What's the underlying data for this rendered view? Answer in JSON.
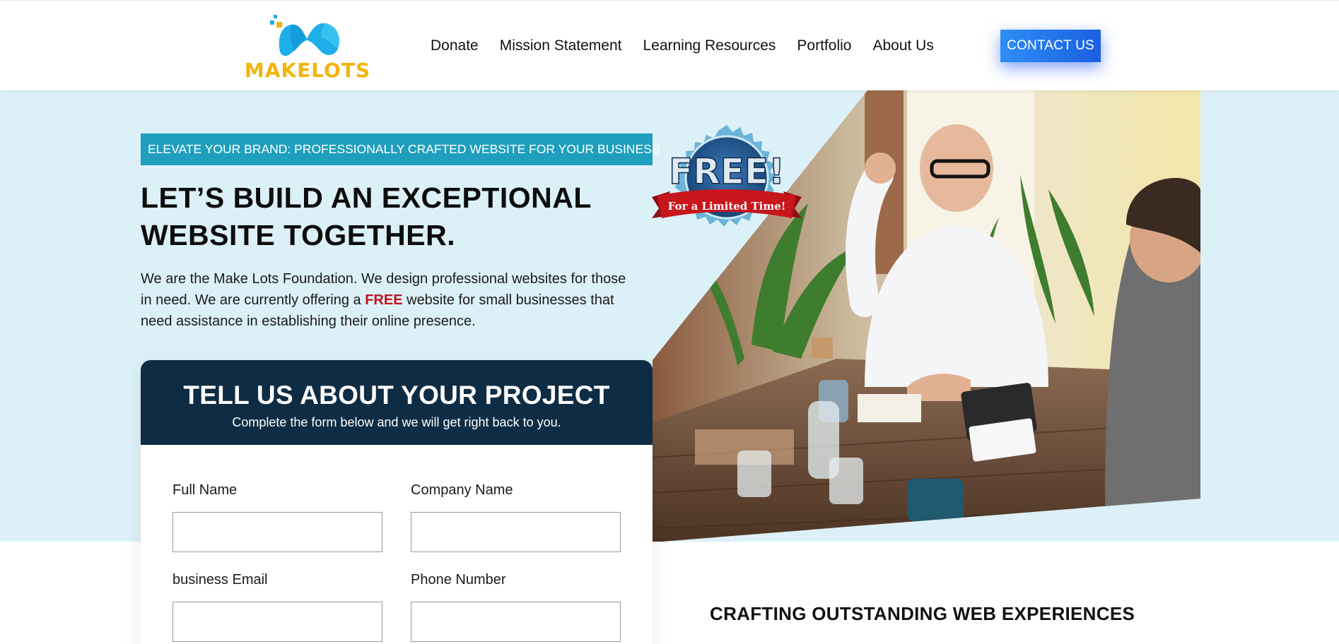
{
  "brand": {
    "name": "MAKELOTS",
    "logo_color": "#f4b40e",
    "logo_mark_color": "#1eaee8"
  },
  "nav": {
    "items": [
      "Donate",
      "Mission Statement",
      "Learning Resources",
      "Portfolio",
      "About Us"
    ],
    "cta_label": "CONTACT US"
  },
  "hero": {
    "tagline": "ELEVATE YOUR BRAND: PROFESSIONALLY CRAFTED WEBSITE FOR YOUR BUSINESS",
    "headline_line1": "LET’S BUILD AN EXCEPTIONAL",
    "headline_line2": "WEBSITE TOGETHER.",
    "intro_before": "We are the Make Lots Foundation. We design professional websites for those in need. We are currently offering a ",
    "intro_highlight": "FREE",
    "intro_after": " website for small businesses that need assistance in establishing their online presence.",
    "badge_main": "FREE!",
    "badge_ribbon": "For a Limited Time!",
    "photo_icon": "office-meeting-photo"
  },
  "form": {
    "title": "TELL US ABOUT YOUR PROJECT",
    "subtitle": "Complete the form below and we will get right back to you.",
    "fields": {
      "full_name": {
        "label": "Full Name",
        "value": ""
      },
      "company_name": {
        "label": "Company Name",
        "value": ""
      },
      "business_email": {
        "label": "business Email",
        "value": ""
      },
      "phone_number": {
        "label": "Phone Number",
        "value": ""
      }
    }
  },
  "section": {
    "heading": "CRAFTING OUTSTANDING WEB EXPERIENCES"
  },
  "colors": {
    "hero_bg": "#dcf0f7",
    "tagline_bg": "#1f9fbd",
    "form_header_bg": "#0e2d44",
    "cta_blue": "#1b5fe0",
    "highlight_red": "#c0141b"
  }
}
